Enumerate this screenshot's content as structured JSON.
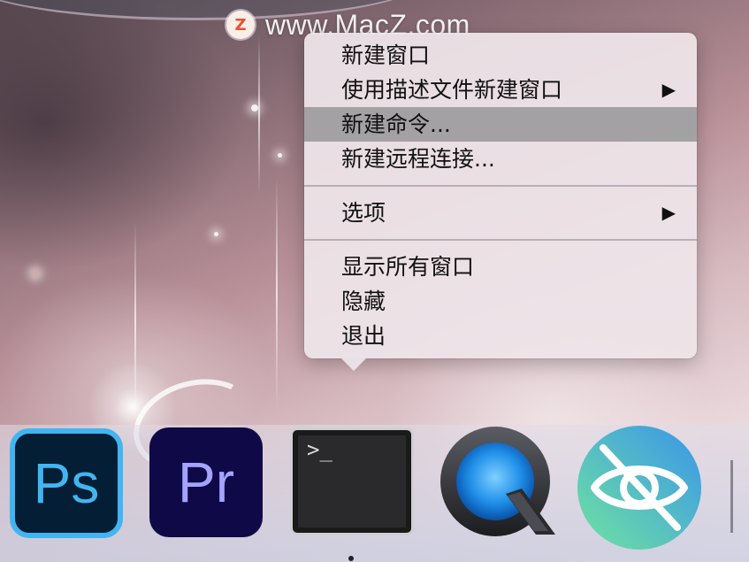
{
  "watermark": {
    "logo_letter": "Z",
    "text": "www.MacZ.com"
  },
  "context_menu": {
    "items": [
      {
        "label": "新建窗口",
        "submenu": false,
        "highlighted": false
      },
      {
        "label": "使用描述文件新建窗口",
        "submenu": true,
        "highlighted": false
      },
      {
        "label": "新建命令...",
        "submenu": false,
        "highlighted": true
      },
      {
        "label": "新建远程连接...",
        "submenu": false,
        "highlighted": false
      },
      {
        "label": "选项",
        "submenu": true,
        "highlighted": false
      },
      {
        "label": "显示所有窗口",
        "submenu": false,
        "highlighted": false
      },
      {
        "label": "隐藏",
        "submenu": false,
        "highlighted": false
      },
      {
        "label": "退出",
        "submenu": false,
        "highlighted": false
      }
    ],
    "submenu_arrow": "▶"
  },
  "dock": {
    "apps": [
      {
        "name": "photoshop",
        "glyph": "Ps",
        "icon": "photoshop-icon"
      },
      {
        "name": "premiere-pro",
        "glyph": "Pr",
        "icon": "premiere-pro-icon"
      },
      {
        "name": "terminal",
        "glyph": ">_",
        "icon": "terminal-icon"
      },
      {
        "name": "quicktime-player",
        "icon": "quicktime-icon"
      },
      {
        "name": "privacy",
        "icon": "eye-slash-icon"
      }
    ]
  },
  "colors": {
    "menu_background": "#eee4e9",
    "menu_highlight": "#969698",
    "ps_blue": "#41b5f0",
    "ps_bg": "#041e36",
    "pr_purple": "#a5a3ff",
    "pr_bg": "#0f0a47",
    "privacy_green": "#5fd3a0",
    "privacy_blue": "#3f9be8"
  }
}
